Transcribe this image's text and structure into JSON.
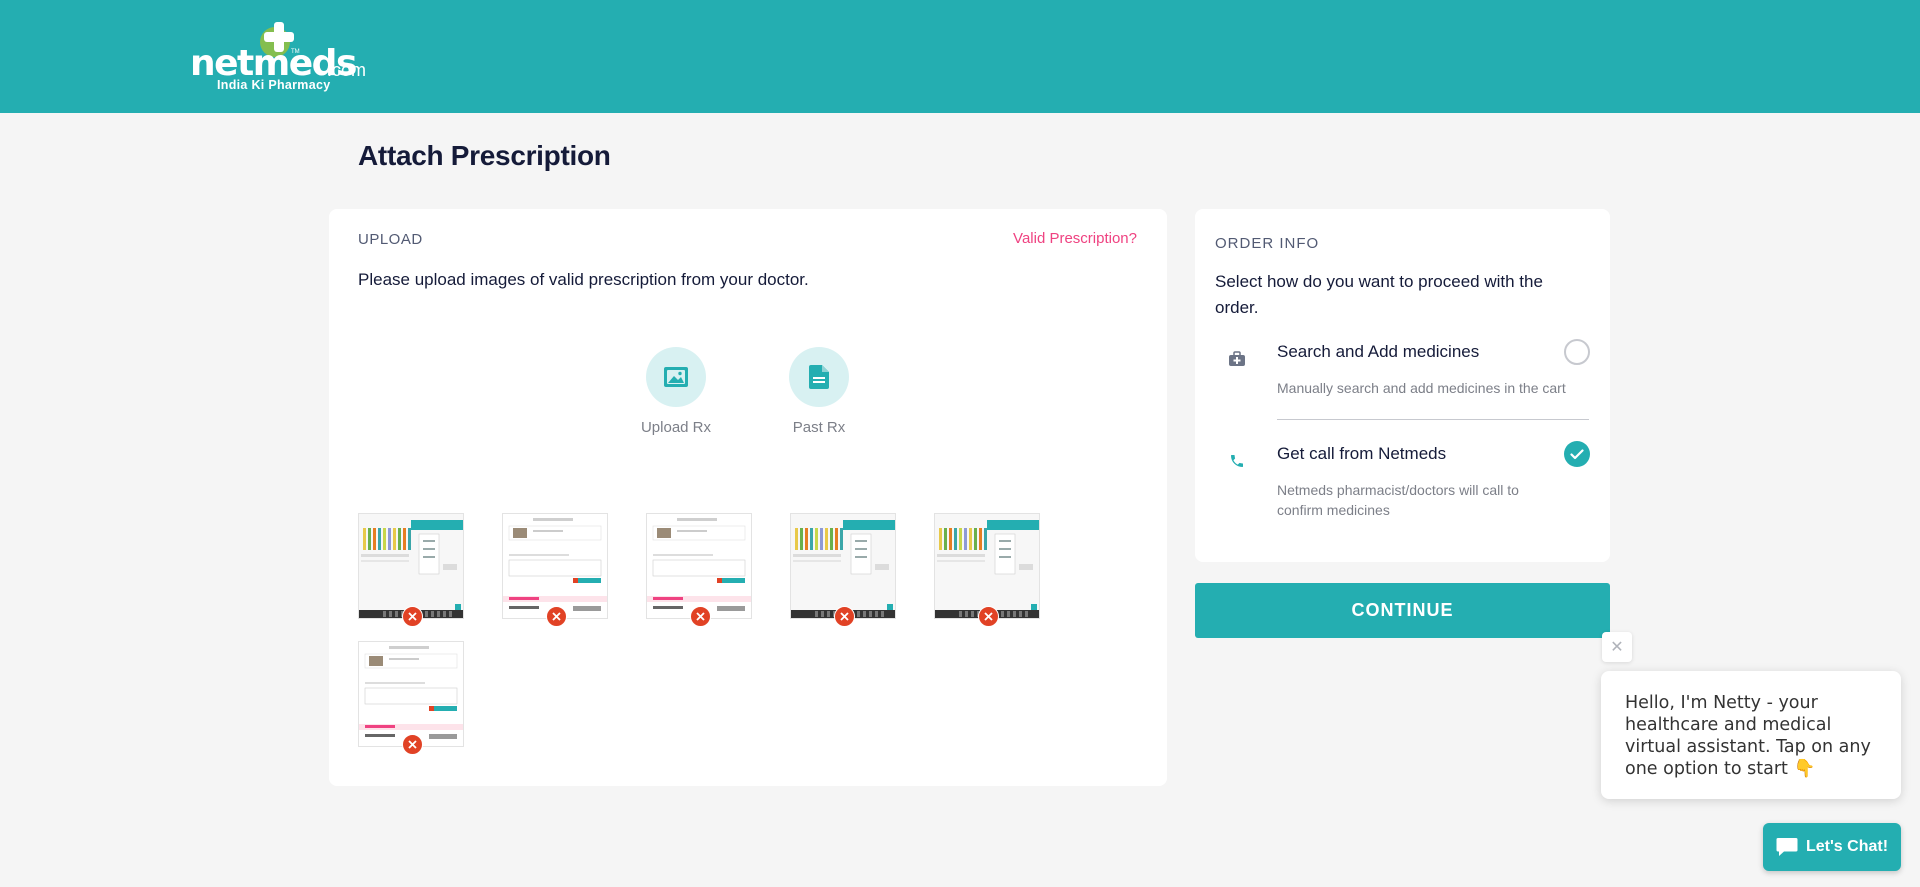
{
  "header": {
    "logo": {
      "word": "netmeds",
      "com": ".com",
      "tm": "TM",
      "tagline": "India Ki Pharmacy"
    },
    "bg_color": "#24aeb1"
  },
  "page_title": "Attach Prescription",
  "upload": {
    "section_label": "UPLOAD",
    "valid_link": "Valid Prescription?",
    "description": "Please upload images of valid prescription from your doctor.",
    "options": [
      {
        "label": "Upload Rx",
        "icon": "image-icon"
      },
      {
        "label": "Past Rx",
        "icon": "document-icon"
      }
    ],
    "thumbnails": [
      {
        "variant": "store"
      },
      {
        "variant": "form"
      },
      {
        "variant": "form"
      },
      {
        "variant": "store"
      },
      {
        "variant": "store"
      },
      {
        "variant": "form"
      }
    ]
  },
  "order_info": {
    "section_label": "ORDER INFO",
    "description": "Select how do you want to proceed with the order.",
    "options": [
      {
        "title": "Search and Add medicines",
        "subtitle": "Manually search and add medicines in the cart",
        "selected": false,
        "icon": "medicine-box-icon"
      },
      {
        "title": "Get call from Netmeds",
        "subtitle": "Netmeds pharmacist/doctors will call to confirm medicines",
        "selected": true,
        "icon": "phone-icon"
      }
    ]
  },
  "continue_label": "CONTINUE",
  "chat": {
    "close_glyph": "✕",
    "message": "Hello, I'm Netty - your healthcare and medical virtual assistant. Tap on any one option to start",
    "emoji": "👇",
    "button_label": "Let's Chat!"
  },
  "colors": {
    "accent": "#24aeb1",
    "link": "#ef4281",
    "delete": "#e14225"
  }
}
